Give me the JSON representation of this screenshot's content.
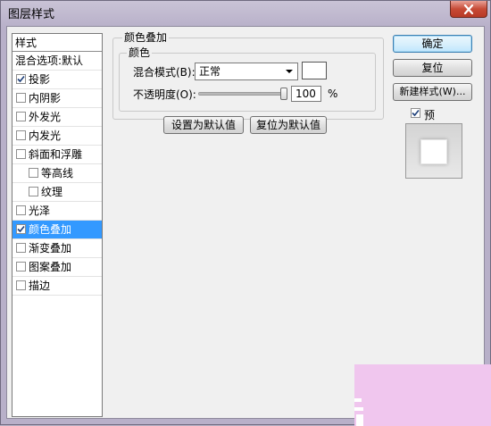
{
  "window": {
    "title": "图层样式"
  },
  "style_list": {
    "header": "样式",
    "items": [
      {
        "label": "混合选项:默认",
        "checkbox": false,
        "checked": false,
        "indent": false,
        "selected": false
      },
      {
        "label": "投影",
        "checkbox": true,
        "checked": true,
        "indent": false,
        "selected": false
      },
      {
        "label": "内阴影",
        "checkbox": true,
        "checked": false,
        "indent": false,
        "selected": false
      },
      {
        "label": "外发光",
        "checkbox": true,
        "checked": false,
        "indent": false,
        "selected": false
      },
      {
        "label": "内发光",
        "checkbox": true,
        "checked": false,
        "indent": false,
        "selected": false
      },
      {
        "label": "斜面和浮雕",
        "checkbox": true,
        "checked": false,
        "indent": false,
        "selected": false
      },
      {
        "label": "等高线",
        "checkbox": true,
        "checked": false,
        "indent": true,
        "selected": false
      },
      {
        "label": "纹理",
        "checkbox": true,
        "checked": false,
        "indent": true,
        "selected": false
      },
      {
        "label": "光泽",
        "checkbox": true,
        "checked": false,
        "indent": false,
        "selected": false
      },
      {
        "label": "颜色叠加",
        "checkbox": true,
        "checked": true,
        "indent": false,
        "selected": true
      },
      {
        "label": "渐变叠加",
        "checkbox": true,
        "checked": false,
        "indent": false,
        "selected": false
      },
      {
        "label": "图案叠加",
        "checkbox": true,
        "checked": false,
        "indent": false,
        "selected": false
      },
      {
        "label": "描边",
        "checkbox": true,
        "checked": false,
        "indent": false,
        "selected": false
      }
    ]
  },
  "color_overlay": {
    "group_title": "颜色叠加",
    "sub_group_title": "颜色",
    "blend_mode_label": "混合模式(B):",
    "blend_mode_value": "正常",
    "overlay_color": "#ffffff",
    "opacity_label": "不透明度(O):",
    "opacity_value": "100",
    "opacity_unit": "%",
    "opacity_percent": 100,
    "make_default_label": "设置为默认值",
    "reset_default_label": "复位为默认值"
  },
  "actions": {
    "ok_label": "确定",
    "reset_label": "复位",
    "new_style_label": "新建样式(W)...",
    "preview_label": "预览(V)",
    "preview_checked": true
  },
  "colors": {
    "selection": "#3399ff",
    "watermark": "#f0c6ee",
    "close_button": "#c74b36"
  },
  "icons": {
    "close": "close-icon",
    "checkmark": "checkmark-icon",
    "dropdown": "chevron-down-icon"
  }
}
